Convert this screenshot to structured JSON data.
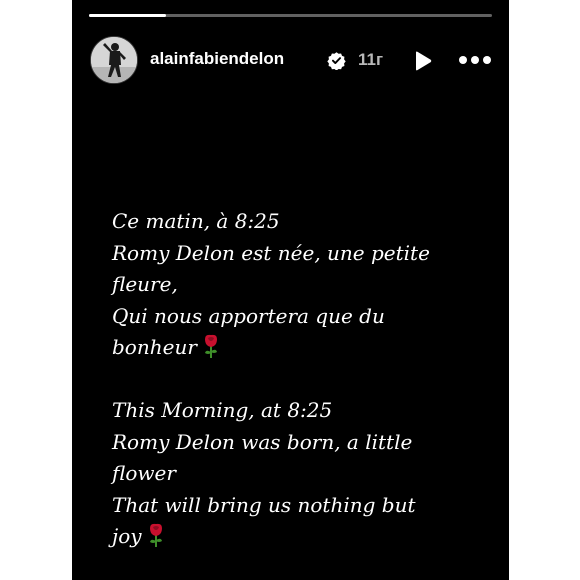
{
  "story": {
    "progress": 0.19,
    "colors": {
      "background": "#000000",
      "text": "#ffffff",
      "timestamp": "#b8b8b8",
      "progress_track": "rgba(255,255,255,0.38)",
      "progress_fill": "#ffffff",
      "rose": "#c8102e"
    },
    "header": {
      "username": "alainfabiendelon",
      "verified_icon": "verified-badge-icon",
      "timestamp": "11г",
      "play_icon": "play-icon",
      "more_icon": "more-horizontal-icon"
    },
    "caption": {
      "french": {
        "line1": "Ce matin, à 8:25",
        "line2": "Romy Delon est née, une petite",
        "line3": "fleure,",
        "line4": "Qui nous apportera que du",
        "line5": "bonheur"
      },
      "english": {
        "line1": "This Morning, at 8:25",
        "line2": "Romy Delon was born, a little",
        "line3": "flower",
        "line4": "That will bring us nothing but",
        "line5": "joy"
      },
      "emoji_icon": "rose-icon"
    }
  }
}
